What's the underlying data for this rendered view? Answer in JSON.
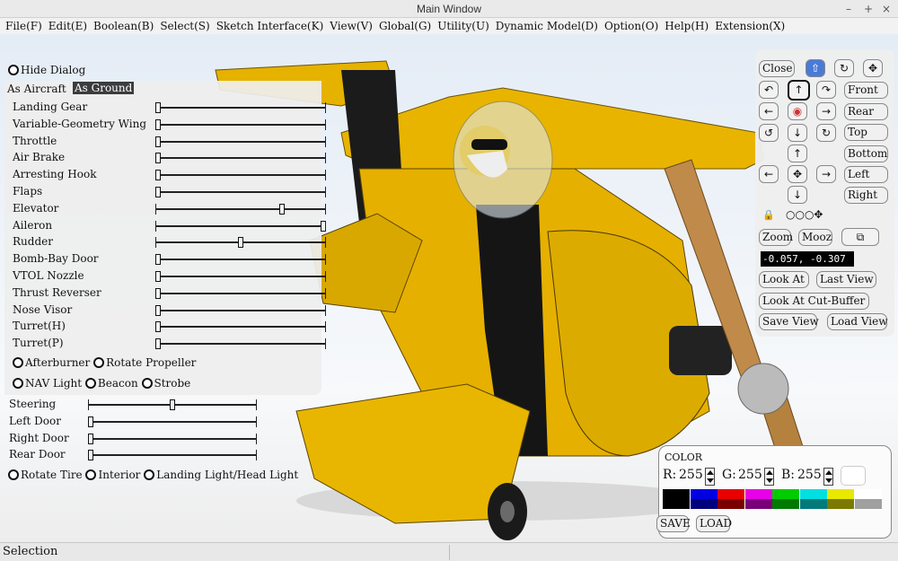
{
  "window": {
    "title": "Main Window",
    "minimize": "–",
    "maximize": "+",
    "close": "×"
  },
  "menu": [
    "File(F)",
    "Edit(E)",
    "Boolean(B)",
    "Select(S)",
    "Sketch Interface(K)",
    "View(V)",
    "Global(G)",
    "Utility(U)",
    "Dynamic Model(D)",
    "Option(O)",
    "Help(H)",
    "Extension(X)"
  ],
  "left": {
    "hide_dialog": "Hide Dialog",
    "tabs": {
      "aircraft": "As Aircraft",
      "ground": "As Ground"
    },
    "sliders": [
      {
        "label": "Landing Gear",
        "value": 0
      },
      {
        "label": "Variable-Geometry Wing",
        "value": 0
      },
      {
        "label": "Throttle",
        "value": 0
      },
      {
        "label": "Air Brake",
        "value": 0
      },
      {
        "label": "Arresting Hook",
        "value": 0
      },
      {
        "label": "Flaps",
        "value": 0
      },
      {
        "label": "Elevator",
        "value": 0.75
      },
      {
        "label": "Aileron",
        "value": 1.0
      },
      {
        "label": "Rudder",
        "value": 0.5
      },
      {
        "label": "Bomb-Bay Door",
        "value": 0
      },
      {
        "label": "VTOL Nozzle",
        "value": 0
      },
      {
        "label": "Thrust Reverser",
        "value": 0
      },
      {
        "label": "Nose Visor",
        "value": 0
      },
      {
        "label": "Turret(H)",
        "value": 0
      },
      {
        "label": "Turret(P)",
        "value": 0
      }
    ],
    "radio_row1": [
      "Afterburner",
      "Rotate Propeller"
    ],
    "radio_row2": [
      "NAV Light",
      "Beacon",
      "Strobe"
    ],
    "ground_sliders": [
      {
        "label": "Steering",
        "value": 0.5
      },
      {
        "label": "Left Door",
        "value": 0
      },
      {
        "label": "Right Door",
        "value": 0
      },
      {
        "label": "Rear Door",
        "value": 0
      }
    ],
    "radio_row3": [
      "Rotate Tire",
      "Interior",
      "Landing Light/Head Light"
    ]
  },
  "right": {
    "close": "Close",
    "views": {
      "front": "Front",
      "rear": "Rear",
      "top": "Top",
      "bottom": "Bottom",
      "left": "Left",
      "right": "Right"
    },
    "zoom": "Zoom",
    "mooz": "Mooz",
    "coords": "-0.057, -0.307",
    "look_at": "Look At",
    "last_view": "Last View",
    "look_at_cut": "Look At Cut-Buffer",
    "save_view": "Save View",
    "load_view": "Load View",
    "nav_glyphs": {
      "home": "⇧",
      "rotate": "↻",
      "move": "✥",
      "rot_l": "↶",
      "up": "↑",
      "rot_r": "↷",
      "left": "←",
      "center": "◉",
      "right": "→",
      "r90l": "↺",
      "down": "↓",
      "r90r": "↻",
      "lock": "🔒",
      "tools": "○○○✥",
      "cut": "⧉"
    }
  },
  "color": {
    "title": "COLOR",
    "r_label": "R:",
    "r": "255",
    "g_label": "G:",
    "g": "255",
    "b_label": "B:",
    "b": "255",
    "preview": "#ffffff",
    "palette_top": [
      "#000000",
      "#0000e0",
      "#e80000",
      "#e800e8",
      "#00cc00",
      "#00e0e0",
      "#e8e800",
      "#ffffff"
    ],
    "palette_bottom": [
      "#000000",
      "#00007a",
      "#7a0000",
      "#7a007a",
      "#007a00",
      "#007a7a",
      "#7a7a00",
      "#a0a0a0"
    ],
    "save": "SAVE",
    "load": "LOAD"
  },
  "status": "Selection"
}
